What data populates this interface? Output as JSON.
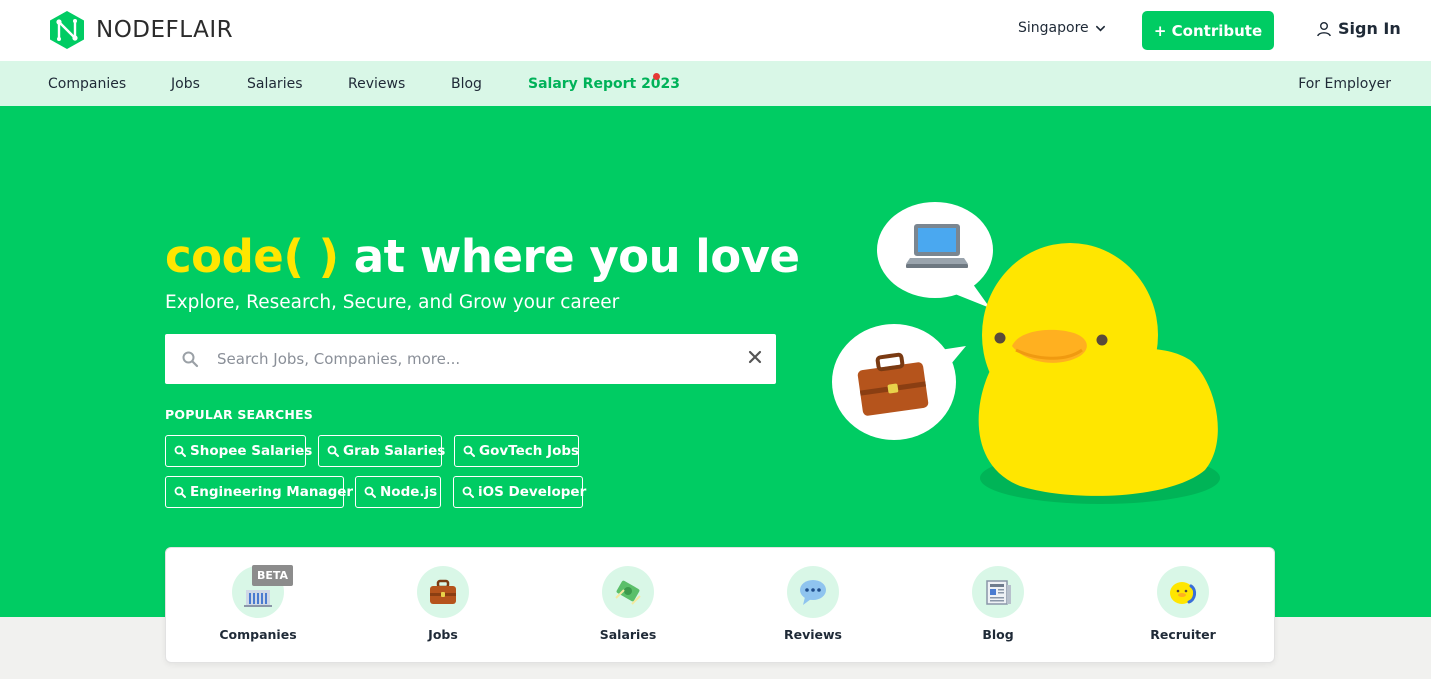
{
  "brand": {
    "name": "NODEFLAIR",
    "accent": "#00cc63",
    "highlight": "#ffe600",
    "nav_bg": "#d9f7e7"
  },
  "header": {
    "country": "Singapore",
    "contribute_label": "+ Contribute",
    "signin_label": "Sign In"
  },
  "nav": {
    "items": [
      "Companies",
      "Jobs",
      "Salaries",
      "Reviews",
      "Blog"
    ],
    "report": "Salary Report 2023",
    "employer": "For Employer"
  },
  "hero": {
    "headline_code": "code( )",
    "headline_rest": "at where you love",
    "subline": "Explore, Research, Secure, and Grow your career",
    "search_placeholder": "Search Jobs, Companies, more...",
    "popular_title": "POPULAR SEARCHES",
    "popular": [
      "Shopee Salaries",
      "Grab Salaries",
      "GovTech Jobs",
      "Engineering Manager",
      "Node.js",
      "iOS Developer"
    ]
  },
  "categories": {
    "beta_badge": "BETA",
    "items": [
      {
        "label": "Companies",
        "icon": "building-icon"
      },
      {
        "label": "Jobs",
        "icon": "briefcase-icon"
      },
      {
        "label": "Salaries",
        "icon": "money-icon"
      },
      {
        "label": "Reviews",
        "icon": "speech-bubble-icon"
      },
      {
        "label": "Blog",
        "icon": "newspaper-icon"
      },
      {
        "label": "Recruiter",
        "icon": "duck-phone-icon"
      }
    ]
  }
}
